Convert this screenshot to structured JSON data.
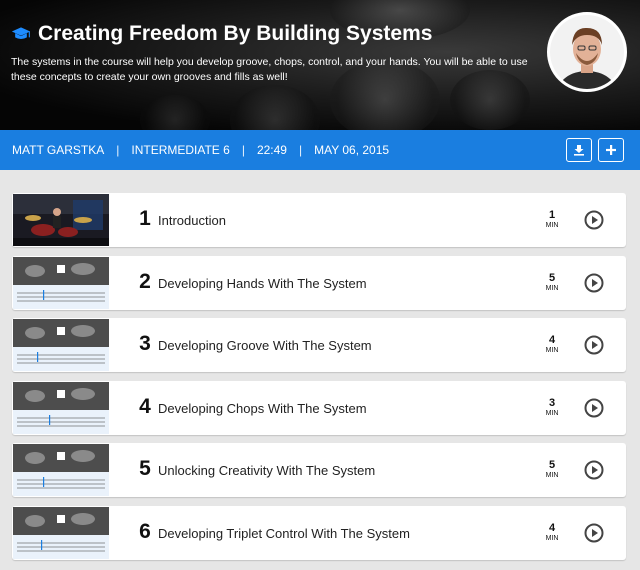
{
  "header": {
    "title": "Creating Freedom By Building Systems",
    "description": "The systems in the course will help you develop groove, chops, control, and your hands. You will be able to use these concepts to create your own grooves and fills as well!",
    "icon": "graduation-cap-icon"
  },
  "meta": {
    "instructor": "MATT GARSTKA",
    "level": "INTERMEDIATE 6",
    "duration": "22:49",
    "date": "MAY 06, 2015",
    "separator": "|",
    "download_icon": "download-icon",
    "add_icon": "plus-icon"
  },
  "lessons": [
    {
      "number": "1",
      "title": "Introduction",
      "minutes": "1",
      "unit": "MIN"
    },
    {
      "number": "2",
      "title": "Developing Hands With The System",
      "minutes": "5",
      "unit": "MIN"
    },
    {
      "number": "3",
      "title": "Developing Groove With The System",
      "minutes": "4",
      "unit": "MIN"
    },
    {
      "number": "4",
      "title": "Developing Chops With The System",
      "minutes": "3",
      "unit": "MIN"
    },
    {
      "number": "5",
      "title": "Unlocking Creativity With The System",
      "minutes": "5",
      "unit": "MIN"
    },
    {
      "number": "6",
      "title": "Developing Triplet Control With The System",
      "minutes": "4",
      "unit": "MIN"
    }
  ],
  "colors": {
    "accent": "#1a7ee0",
    "cap_icon": "#1e8cff",
    "background": "#e6e6e6"
  }
}
